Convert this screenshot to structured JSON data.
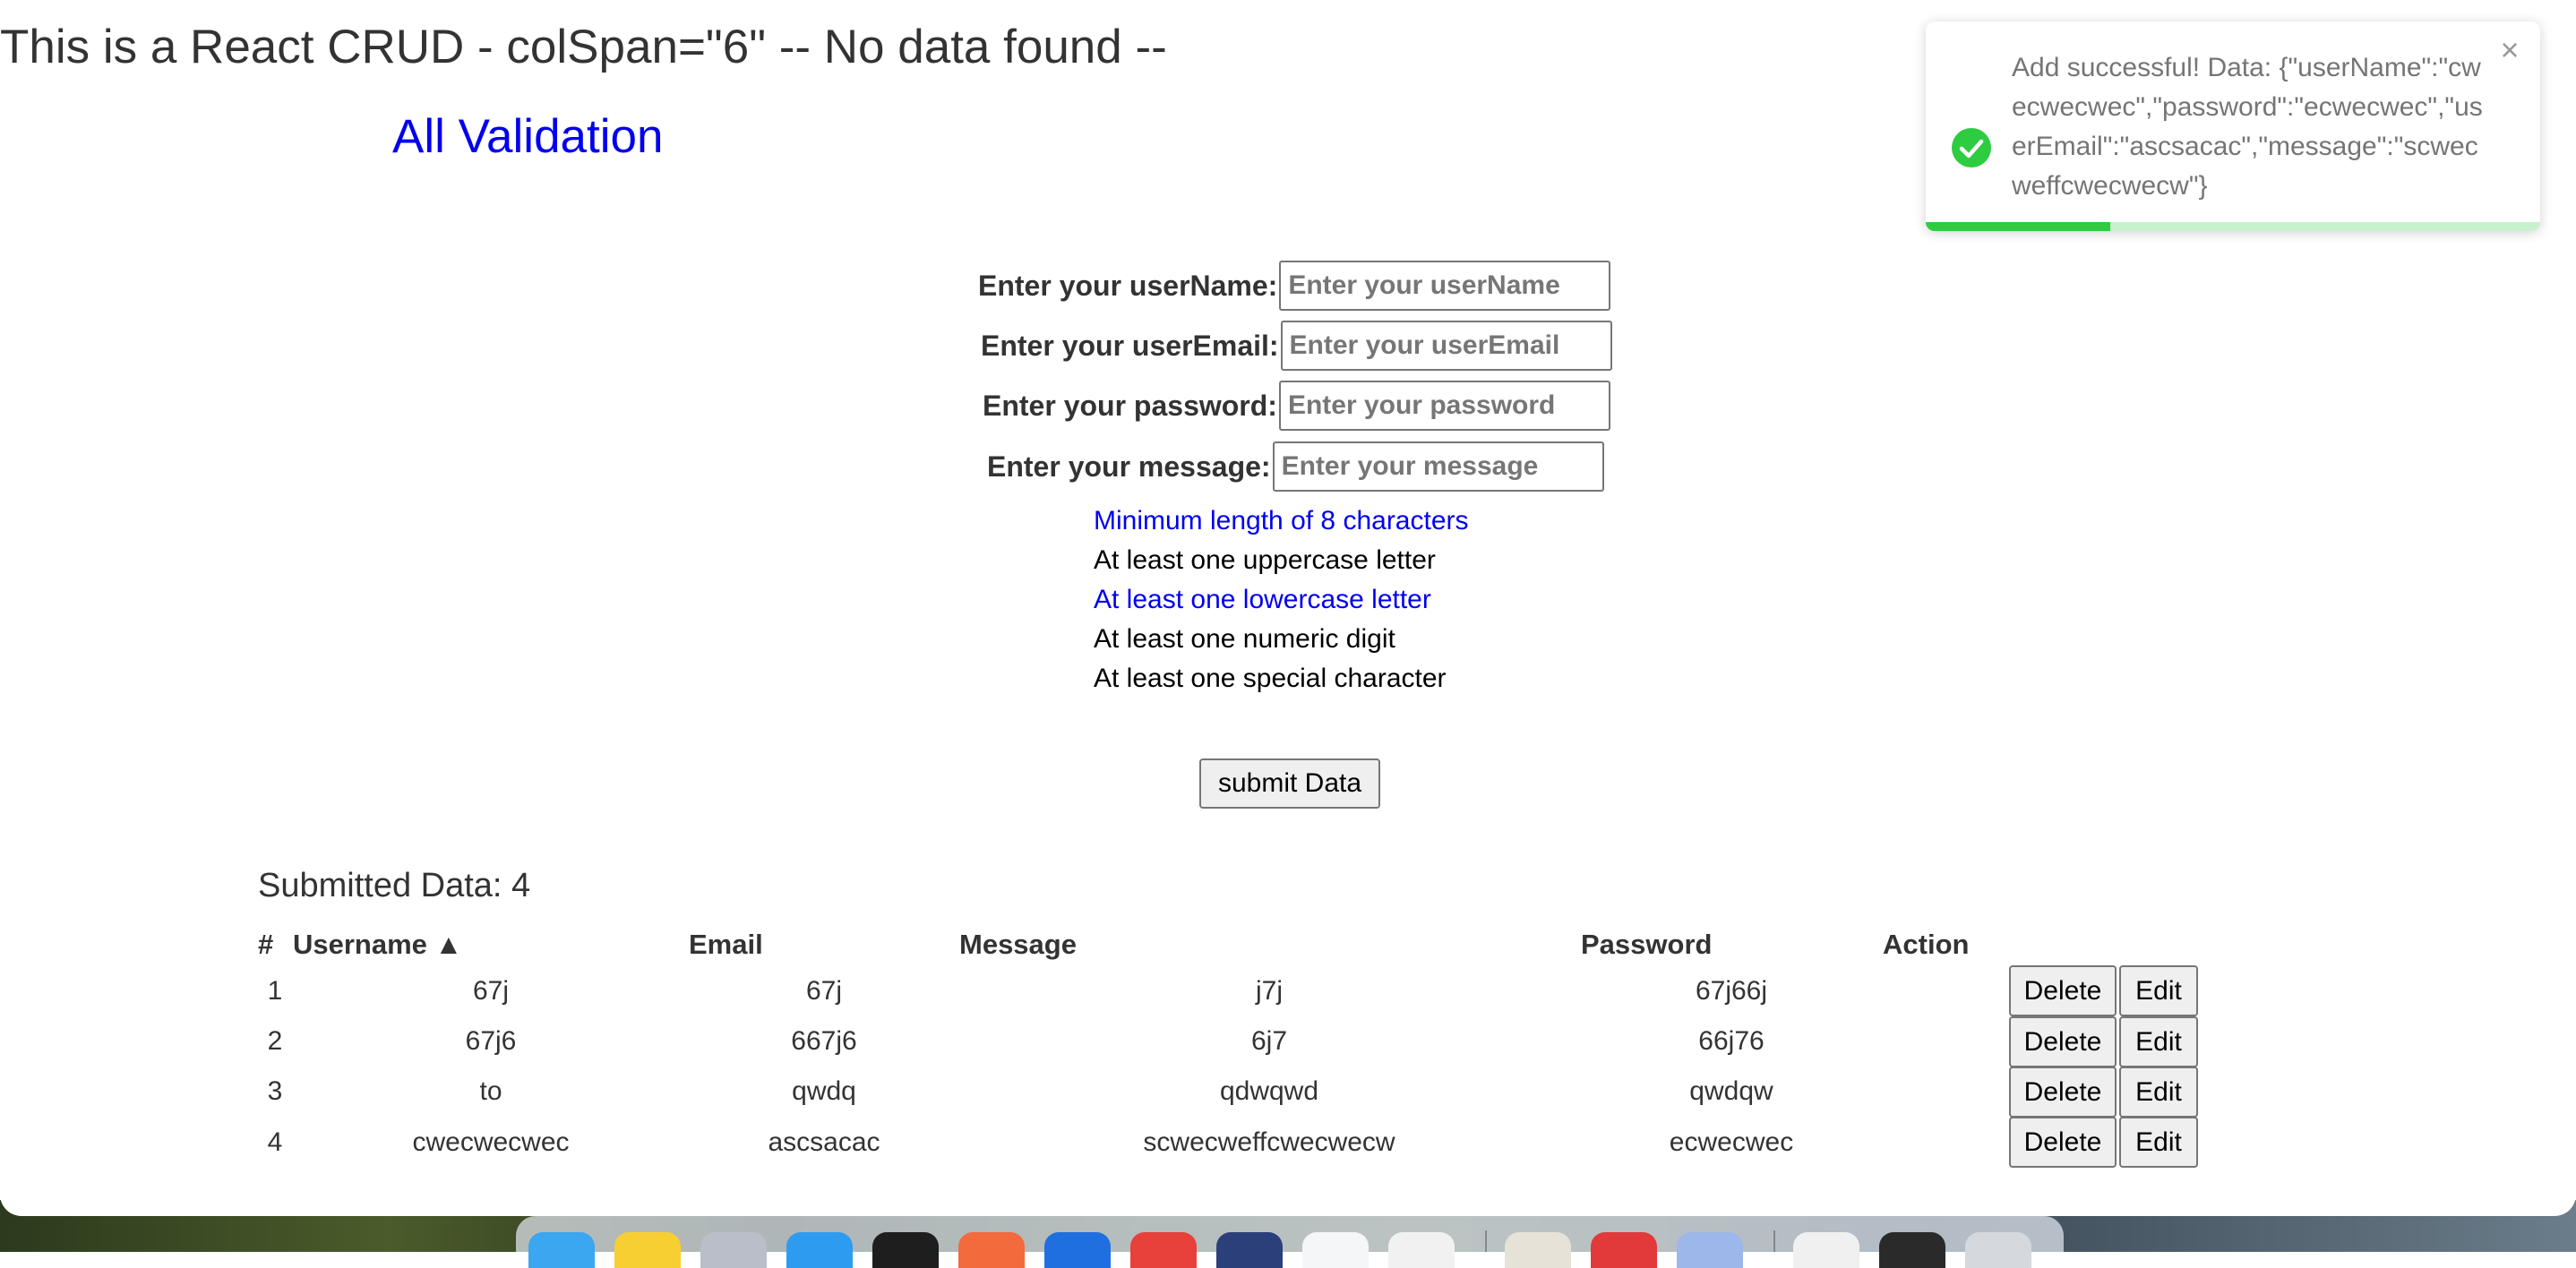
{
  "page": {
    "heading": "This is a React CRUD - colSpan=\"6\" -- No data found --",
    "subheading": "All Validation"
  },
  "form": {
    "fields": [
      {
        "label": "Enter your userName:",
        "placeholder": "Enter your userName",
        "value": ""
      },
      {
        "label": "Enter your userEmail:",
        "placeholder": "Enter your userEmail",
        "value": ""
      },
      {
        "label": "Enter your password:",
        "placeholder": "Enter your password",
        "value": ""
      },
      {
        "label": "Enter your message:",
        "placeholder": "Enter your message",
        "value": ""
      }
    ],
    "password_rules": [
      {
        "text": "Minimum length of 8 characters",
        "met": true
      },
      {
        "text": "At least one uppercase letter",
        "met": false
      },
      {
        "text": "At least one lowercase letter",
        "met": true
      },
      {
        "text": "At least one numeric digit",
        "met": false
      },
      {
        "text": "At least one special character",
        "met": false
      }
    ],
    "submit_label": "submit Data"
  },
  "submitted": {
    "title": "Submitted Data: 4",
    "columns": [
      "#",
      "Username ▲",
      "Email",
      "Message",
      "Password",
      "Action"
    ],
    "rows": [
      {
        "index": "1",
        "username": "67j",
        "email": "67j",
        "message": "j7j",
        "password": "67j66j"
      },
      {
        "index": "2",
        "username": "67j6",
        "email": "667j6",
        "message": "6j7",
        "password": "66j76"
      },
      {
        "index": "3",
        "username": "to",
        "email": "qwdq",
        "message": "qdwqwd",
        "password": "qwdqw"
      },
      {
        "index": "4",
        "username": "cwecwecwec",
        "email": "ascsacac",
        "message": "scwecweffcwecwecw",
        "password": "ecwecwec"
      }
    ],
    "delete_label": "Delete",
    "edit_label": "Edit"
  },
  "toast": {
    "message": "Add successful! Data: {\"userName\":\"cwecwecwec\",\"password\":\"ecwecwec\",\"userEmail\":\"ascsacac\",\"message\":\"scwecweffcwecwecw\"}",
    "close_symbol": "×",
    "progress_fraction": 0.3,
    "colors": {
      "success": "#2ecc40",
      "track": "#c7f0cd"
    }
  },
  "colors": {
    "link_blue": "#0000ee",
    "text": "#333333"
  }
}
